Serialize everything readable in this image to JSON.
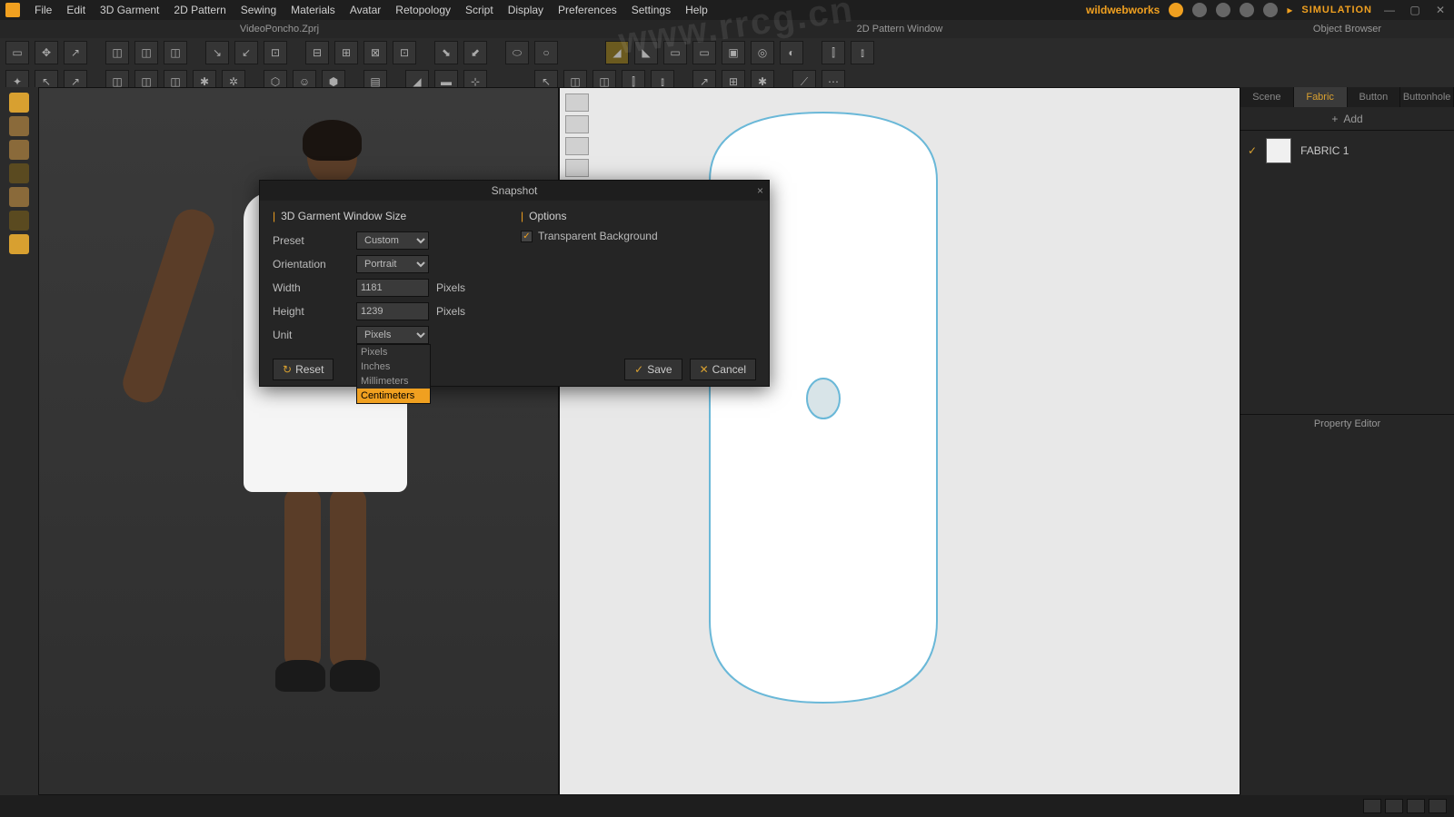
{
  "menu": {
    "items": [
      "File",
      "Edit",
      "3D Garment",
      "2D Pattern",
      "Sewing",
      "Materials",
      "Avatar",
      "Retopology",
      "Script",
      "Display",
      "Preferences",
      "Settings",
      "Help"
    ],
    "brand": "wildwebworks",
    "simulation": "SIMULATION"
  },
  "windows": {
    "file_title": "VideoPoncho.Zprj",
    "w2d": "2D Pattern Window",
    "obj": "Object Browser"
  },
  "obj_tabs": [
    "Scene",
    "Fabric",
    "Button",
    "Buttonhole"
  ],
  "obj_active_tab": "Fabric",
  "add_label": "Add",
  "fabric_name": "FABRIC 1",
  "prop_editor": "Property Editor",
  "dialog": {
    "title": "Snapshot",
    "section1": "3D Garment Window Size",
    "section2": "Options",
    "preset_label": "Preset",
    "preset_value": "Custom",
    "orientation_label": "Orientation",
    "orientation_value": "Portrait",
    "width_label": "Width",
    "width_value": "1181",
    "height_label": "Height",
    "height_value": "1239",
    "unit_label": "Unit",
    "pixels": "Pixels",
    "unit_options": [
      "Pixels",
      "Inches",
      "Millimeters",
      "Centimeters"
    ],
    "transparent_bg": "Transparent Background",
    "reset": "Reset",
    "save": "Save",
    "cancel": "Cancel"
  },
  "watermark_url": "www.rrcg.cn"
}
